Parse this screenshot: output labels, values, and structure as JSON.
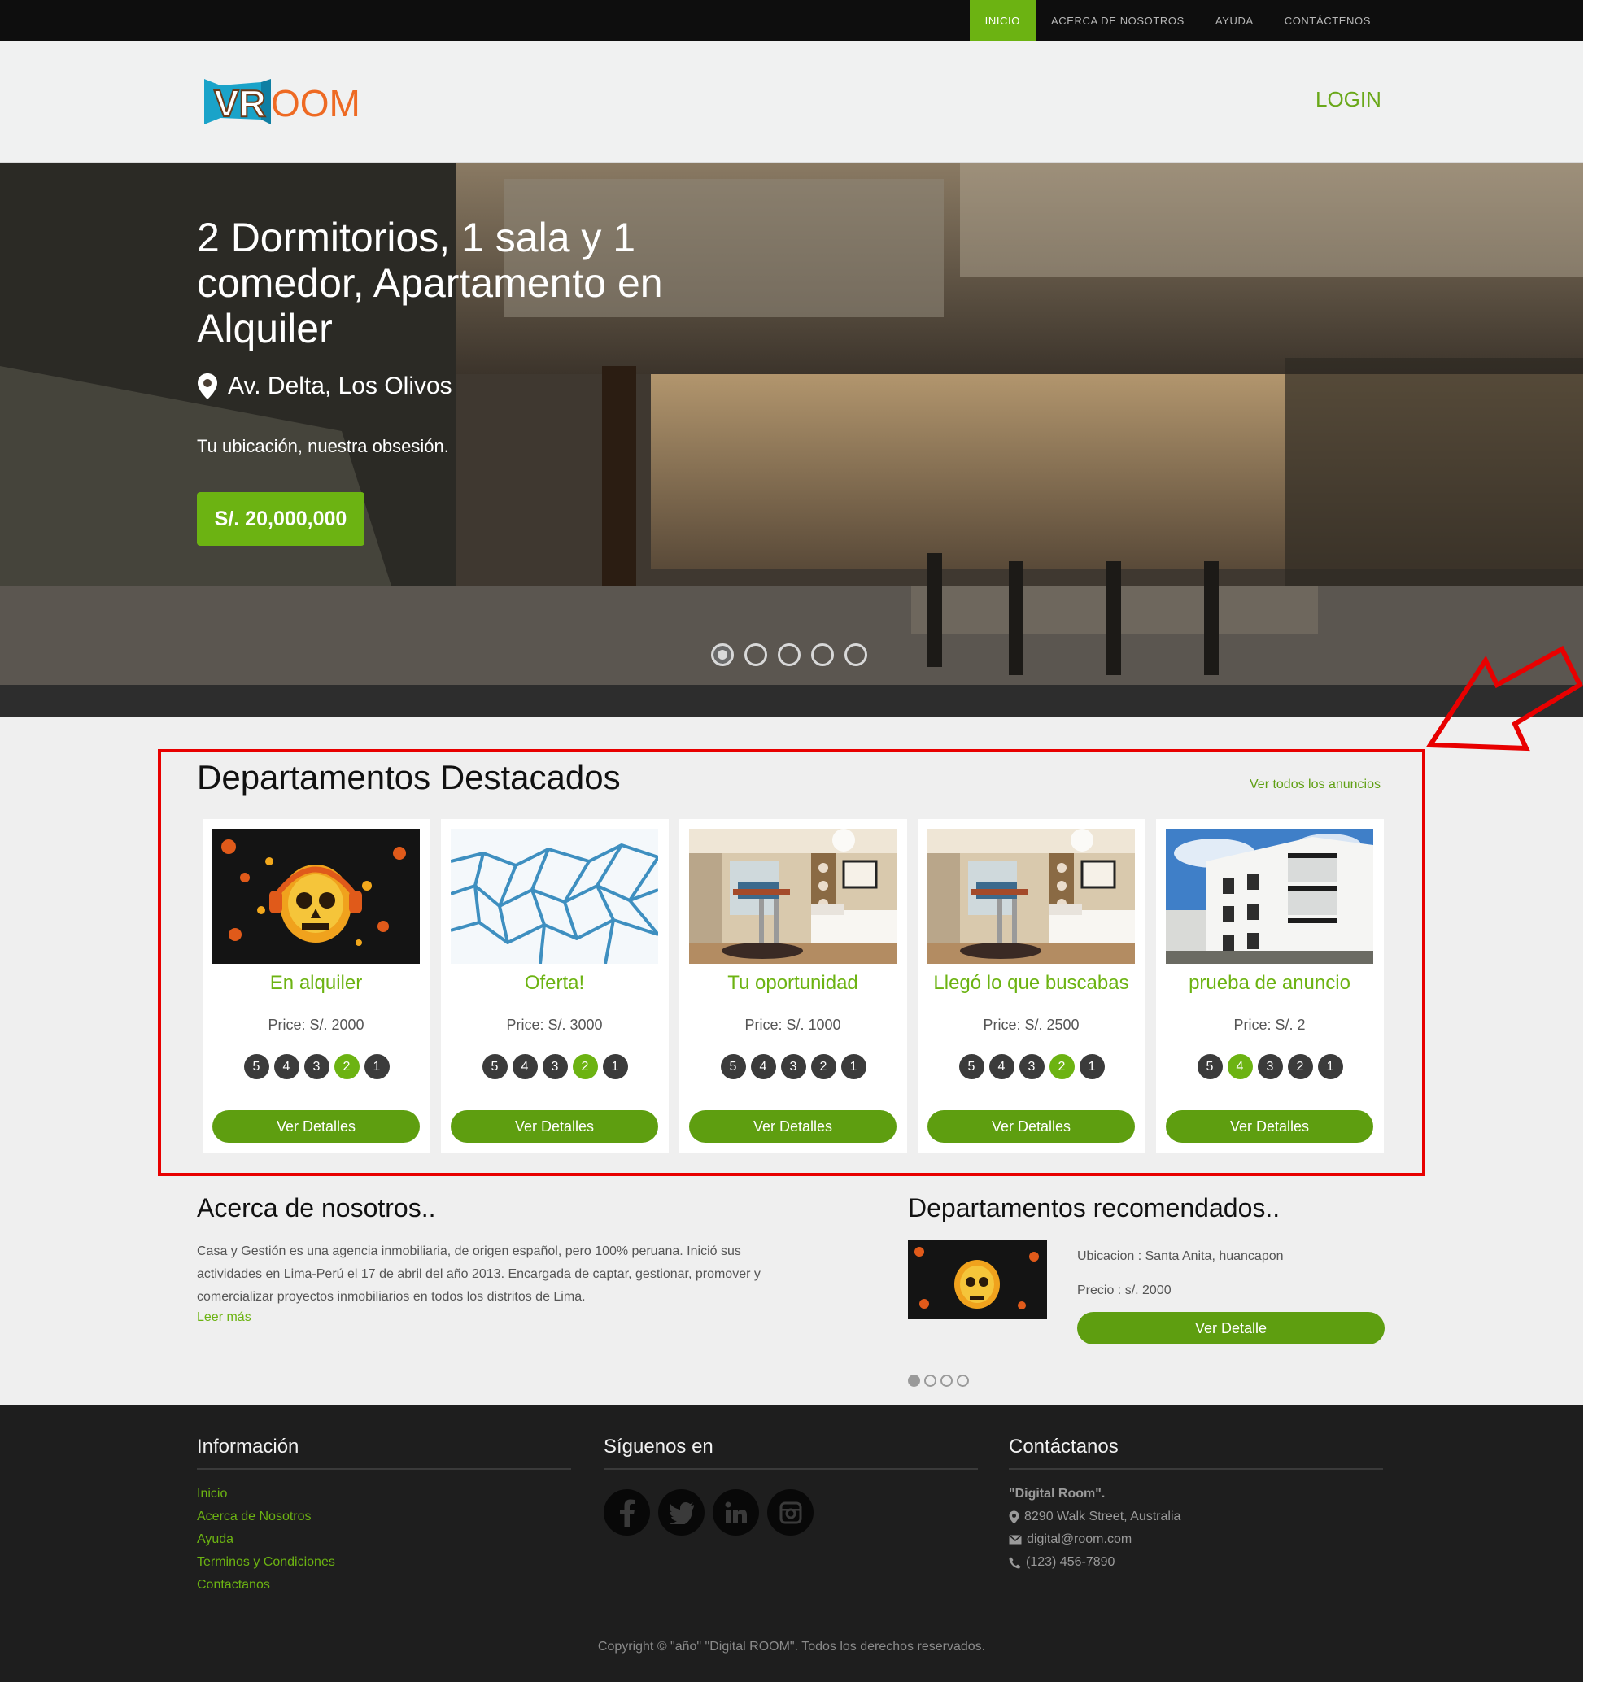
{
  "topnav": {
    "items": [
      {
        "label": "INICIO",
        "active": true
      },
      {
        "label": "ACERCA DE NOSOTROS",
        "active": false
      },
      {
        "label": "AYUDA",
        "active": false
      },
      {
        "label": "CONTÁCTENOS",
        "active": false
      }
    ]
  },
  "header": {
    "logo_text": "VROOM",
    "login_label": "LOGIN"
  },
  "hero": {
    "title": "2 Dormitorios, 1 sala y 1 comedor, Apartamento en Alquiler",
    "location": "Av. Delta, Los Olivos",
    "tagline": "Tu ubicación, nuestra obsesión.",
    "price": "S/. 20,000,000",
    "slides": 5,
    "active_slide": 1
  },
  "featured": {
    "title": "Departamentos Destacados",
    "see_all": "Ver todos los anuncios",
    "button_label": "Ver Detalles",
    "cards": [
      {
        "title": "En alquiler",
        "price": "Price: S/. 2000",
        "rating_active": "2",
        "image": "skull-art"
      },
      {
        "title": "Oferta!",
        "price": "Price: S/. 3000",
        "rating_active": "2",
        "image": "cracked-ice"
      },
      {
        "title": "Tu oportunidad",
        "price": "Price: S/. 1000",
        "rating_active": "",
        "image": "bedroom"
      },
      {
        "title": "Llegó lo que buscabas",
        "price": "Price: S/. 2500",
        "rating_active": "2",
        "image": "bedroom"
      },
      {
        "title": "prueba de anuncio",
        "price": "Price: S/. 2",
        "rating_active": "4",
        "image": "apartment-building"
      }
    ],
    "rating_labels": [
      "5",
      "4",
      "3",
      "2",
      "1"
    ]
  },
  "about": {
    "title": "Acerca de nosotros..",
    "text": "Casa y Gestión es una agencia inmobiliaria, de origen español, pero 100% peruana. Inició sus actividades en Lima-Perú el 17 de abril del año 2013. Encargada de captar, gestionar, promover y comercializar proyectos inmobiliarios en todos los distritos de Lima.",
    "more_label": "Leer más"
  },
  "recommended": {
    "title": "Departamentos recomendados..",
    "location": "Ubicacion : Santa Anita, huancapon",
    "price": "Precio : s/. 2000",
    "button_label": "Ver Detalle",
    "slides": 4
  },
  "footer": {
    "info_title": "Información",
    "info_links": [
      "Inicio",
      "Acerca de Nosotros",
      "Ayuda",
      "Terminos y Condiciones",
      "Contactanos"
    ],
    "social_title": "Síguenos en",
    "social_icons": [
      "facebook-icon",
      "twitter-icon",
      "linkedin-icon",
      "instagram-icon"
    ],
    "contact_title": "Contáctanos",
    "contact_name": "\"Digital Room\".",
    "contact_address": "8290 Walk Street, Australia",
    "contact_email": "digital@room.com",
    "contact_phone": "(123) 456-7890",
    "copyright": "Copyright © \"año\" \"Digital ROOM\". Todos los derechos reservados."
  },
  "colors": {
    "accent": "#6cb312",
    "highlight": "#e80000"
  }
}
